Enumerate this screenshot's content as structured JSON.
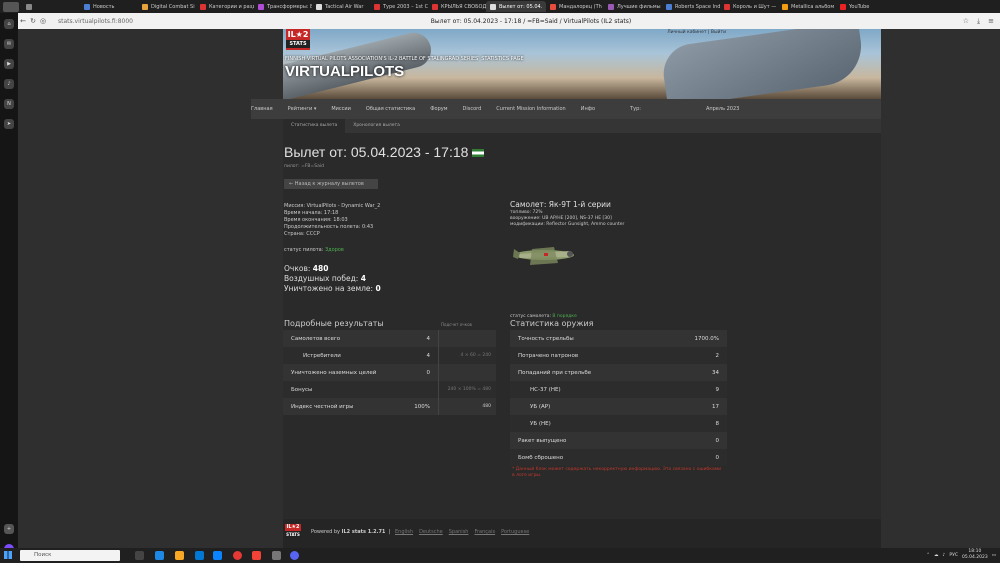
{
  "browser": {
    "tabs": [
      {
        "title": "",
        "color": "#888"
      },
      {
        "title": "Новость",
        "color": "#4a7fd4"
      },
      {
        "title": "Digital Combat Si",
        "color": "#e8a33d"
      },
      {
        "title": "Категории и разд",
        "color": "#d33"
      },
      {
        "title": "Трансформеры: В",
        "color": "#b04dd6"
      },
      {
        "title": "Tactical Air War",
        "color": "#ddd"
      },
      {
        "title": "Туре 2003 – 1st Ch",
        "color": "#d33"
      },
      {
        "title": "КРЫЛЬЯ СВОБОД",
        "color": "#d33"
      },
      {
        "title": "Вылет от: 05.04.",
        "color": "#ddd"
      },
      {
        "title": "Мандалорец (Th",
        "color": "#e74c3c"
      },
      {
        "title": "Лучшие фильмы",
        "color": "#9b59b6"
      },
      {
        "title": "Roberts Space Ind",
        "color": "#4a7fd4"
      },
      {
        "title": "Король и Шут —",
        "color": "#d33"
      },
      {
        "title": "Metallica альбом",
        "color": "#f39c12"
      },
      {
        "title": "YouTube",
        "color": "#e22"
      }
    ],
    "url": "stats.virtualpilots.fi:8000",
    "page_title": "Вылет от: 05.04.2023 - 17:18 / =FB=Said / VirtualPilots (IL2 stats)"
  },
  "header": {
    "logo_top": "IL★2",
    "logo_bottom": "STATS",
    "association": "FINNISH VIRTUAL PILOTS ASSOCIATION'S IL-2 BATTLE OF STALINGRAD SERIES' STATISTICS PAGE",
    "site_name": "VIRTUALPILOTS",
    "user_links": "Личный кабинет | Выйти"
  },
  "nav": [
    "Главная",
    "Рейтинги ▾",
    "Миссии",
    "Общая статистика",
    "Форум",
    "Discord",
    "Current Mission Information",
    "Инфо",
    "Тур:",
    "Апрель 2023"
  ],
  "subnav": [
    "Статистика вылета",
    "Хронология вылета"
  ],
  "sortie": {
    "title": "Вылет от: 05.04.2023 - 17:18",
    "pilot": "пилот: =FB=Said",
    "back": "← Назад к журналу вылетов",
    "mission": "Миссия: VirtualPilots - Dynamic War_2",
    "start": "Время начала: 17:18",
    "end": "Время окончания: 18:03",
    "duration": "Продолжительность полета: 0:43",
    "country": "Страна: СССР",
    "pilot_status_label": "статус пилота:",
    "pilot_status": "Здоров",
    "score_label": "Очков:",
    "score": "480",
    "air_label": "Воздушных побед:",
    "air": "4",
    "ground_label": "Уничтожено на земле:",
    "ground": "0"
  },
  "aircraft": {
    "title": "Самолет: Як-9Т 1-й серии",
    "fuel": "топливо: 72%",
    "weapons": "вооружение: UB AP/HE [200], NS-37 HE [30]",
    "mods": "модификации: Reflector Gunsight, Ammo counter",
    "status_label": "статус самолета:",
    "status": "В порядке"
  },
  "results": {
    "heading": "Подробные результаты",
    "calc_heading": "Подсчет очков",
    "rows": [
      {
        "label": "Самолетов всего",
        "value": "4",
        "calc": ""
      },
      {
        "label": "Истребители",
        "value": "4",
        "calc": "4 × 60 = 240"
      },
      {
        "label": "Уничтожено наземных целей",
        "value": "0",
        "calc": ""
      },
      {
        "label": "Бонусы",
        "value": "",
        "calc": "240 × 100% = 480"
      },
      {
        "label": "Индекс честной игры",
        "value": "100%",
        "calc": "480"
      }
    ]
  },
  "weapons": {
    "heading": "Статистика оружия",
    "rows": [
      {
        "label": "Точность стрельбы",
        "value": "1700.0%"
      },
      {
        "label": "Потрачено патронов",
        "value": "2"
      },
      {
        "label": "Попаданий при стрельбе",
        "value": "34"
      },
      {
        "label": "НС-37 (HE)",
        "value": "9"
      },
      {
        "label": "УБ (AP)",
        "value": "17"
      },
      {
        "label": "УБ (HE)",
        "value": "8"
      },
      {
        "label": "Ракет выпущено",
        "value": "0"
      },
      {
        "label": "Бомб сброшено",
        "value": "0"
      }
    ],
    "note": "* Данный блок может содержать некорректную информацию. Это связано с ошибками в логе игры."
  },
  "footer": {
    "powered": "Powered by",
    "product": "IL2 stats 1.2.71",
    "langs": [
      "English",
      "Deutsche",
      "Spanish",
      "Français",
      "Portuguese"
    ]
  },
  "taskbar": {
    "search": "Поиск",
    "lang": "РУС",
    "time": "18:10",
    "date": "05.04.2023"
  }
}
